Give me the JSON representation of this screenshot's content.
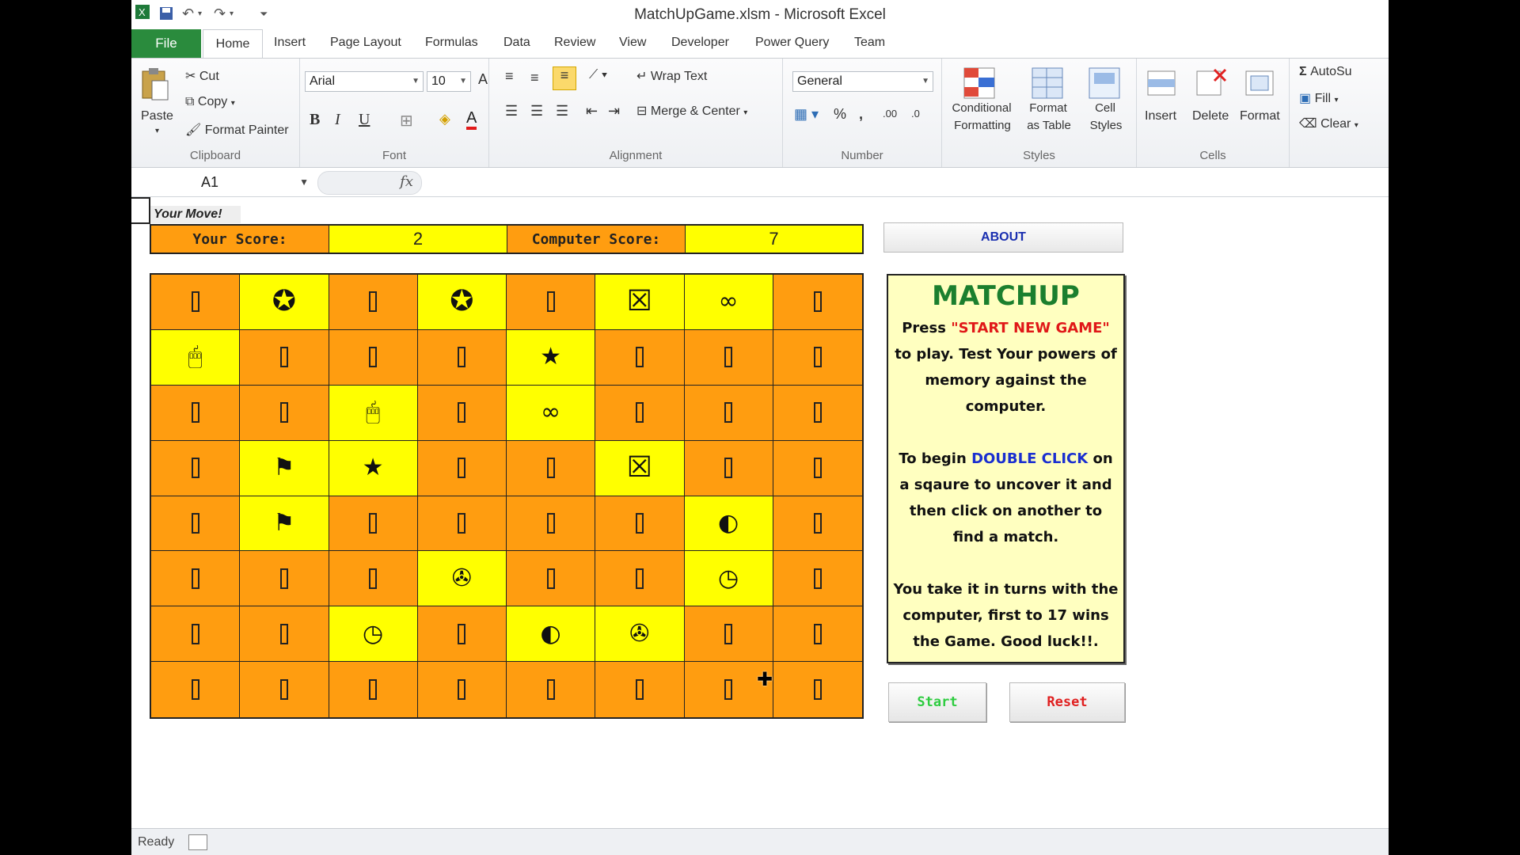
{
  "window": {
    "title": "MatchUpGame.xlsm - Microsoft Excel"
  },
  "ribbon_tabs": [
    "File",
    "Home",
    "Insert",
    "Page Layout",
    "Formulas",
    "Data",
    "Review",
    "View",
    "Developer",
    "Power Query",
    "Team"
  ],
  "clipboard": {
    "paste": "Paste",
    "cut": "Cut",
    "copy": "Copy",
    "format_painter": "Format Painter",
    "label": "Clipboard"
  },
  "font": {
    "name": "Arial",
    "size": "10",
    "label": "Font"
  },
  "alignment": {
    "wrap_text": "Wrap Text",
    "merge_center": "Merge & Center",
    "label": "Alignment"
  },
  "number": {
    "format": "General",
    "label": "Number"
  },
  "styles": {
    "conditional_formatting_1": "Conditional",
    "conditional_formatting_2": "Formatting",
    "format_table_1": "Format",
    "format_table_2": "as Table",
    "cell_styles_1": "Cell",
    "cell_styles_2": "Styles",
    "label": "Styles"
  },
  "cells": {
    "insert": "Insert",
    "delete": "Delete",
    "format": "Format",
    "label": "Cells"
  },
  "editing": {
    "autosum": "AutoSu",
    "fill": "Fill",
    "clear": "Clear"
  },
  "formula_bar": {
    "name_box": "A1",
    "fx": "fx"
  },
  "game": {
    "status": "Your Move!",
    "your_score_label": "Your Score:",
    "your_score": "2",
    "computer_score_label": "Computer Score:",
    "computer_score": "7",
    "about": "ABOUT",
    "start": "Start",
    "reset": "Reset",
    "board": [
      [
        "",
        "star-circle",
        "",
        "star-circle",
        "",
        "box-x",
        "glasses",
        ""
      ],
      [
        "mouse",
        "",
        "",
        "",
        "star",
        "",
        "",
        ""
      ],
      [
        "",
        "",
        "mouse",
        "",
        "glasses",
        "",
        "",
        ""
      ],
      [
        "",
        "windows-flag",
        "star",
        "",
        "",
        "box-x",
        "",
        ""
      ],
      [
        "",
        "windows-flag",
        "",
        "",
        "",
        "",
        "pac",
        ""
      ],
      [
        "",
        "",
        "",
        "tape",
        "",
        "",
        "clock",
        ""
      ],
      [
        "",
        "",
        "clock",
        "",
        "pac",
        "tape",
        "",
        ""
      ],
      [
        "",
        "",
        "",
        "",
        "",
        "",
        "",
        ""
      ]
    ],
    "symbols": {
      "star-circle": "✪",
      "box-x": "☒",
      "glasses": "∞",
      "mouse": "🖱",
      "star": "★",
      "windows-flag": "⚑",
      "pac": "◐",
      "tape": "✇",
      "clock": "◷"
    }
  },
  "info": {
    "title": "MATCHUP",
    "press": "Press ",
    "start_new_game": "\"START NEW GAME\"",
    "line1": "to play. Test Your powers of memory against the computer.",
    "to_begin": "To begin ",
    "double_click": "DOUBLE CLICK",
    "line2": " on a sqaure to uncover it and then click on another to find a match.",
    "line3": "You take it in turns with the computer, first to 17 wins the Game. Good luck!!."
  },
  "status_bar": {
    "ready": "Ready"
  }
}
